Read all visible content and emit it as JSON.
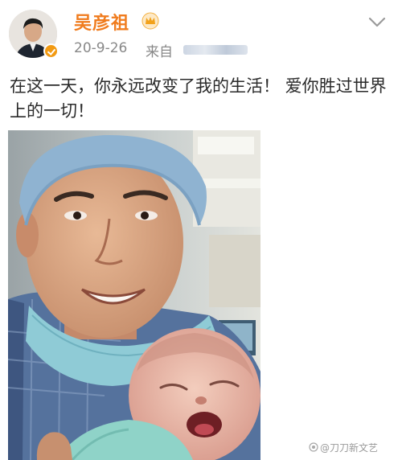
{
  "user": {
    "name": "吴彦祖"
  },
  "post": {
    "date": "20-9-26",
    "source_label": "来自",
    "text": "在这一天，你永远改变了我的生活！ 爱你胜过世界上的一切！"
  },
  "watermark": {
    "text": "@刀刀新文艺"
  },
  "colors": {
    "username": "#f07c1e",
    "meta": "#888888",
    "verified_badge": "#f29a12"
  },
  "icons": {
    "verified": "verified-badge-icon",
    "vip": "crown-icon",
    "menu": "chevron-down-icon"
  }
}
